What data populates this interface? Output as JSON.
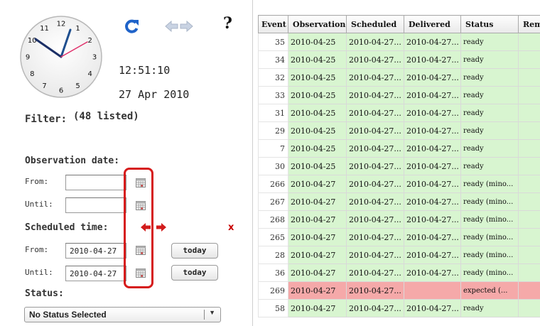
{
  "clock": {
    "numerals": [
      "12",
      "1",
      "2",
      "3",
      "4",
      "5",
      "6",
      "7",
      "8",
      "9",
      "10",
      "11"
    ],
    "time": "12:51:10",
    "date": "27 Apr 2010"
  },
  "toolbar": {
    "refresh_icon": "refresh-icon",
    "back_icon": "arrow-left-icon",
    "forward_icon": "arrow-right-icon",
    "help_label": "?"
  },
  "filter": {
    "label": "Filter:",
    "count": "(48 listed)",
    "observation": {
      "title": "Observation date:",
      "from_label": "From:",
      "from_value": "",
      "until_label": "Until:",
      "until_value": ""
    },
    "scheduled": {
      "title": "Scheduled time:",
      "from_label": "From:",
      "from_value": "2010-04-27",
      "until_label": "Until:",
      "until_value": "2010-04-27",
      "today_label": "today",
      "clear_label": "x"
    },
    "status": {
      "title": "Status:",
      "selected": "No Status Selected",
      "caret": "▼"
    }
  },
  "colors": {
    "ok_row": "#d8f5d0",
    "expected_row": "#f5a9a9",
    "highlight_box": "#d61b1b",
    "refresh_icon": "#1f63c9"
  },
  "table": {
    "columns": [
      "Event",
      "Observation",
      "Scheduled",
      "Delivered",
      "Status",
      "Remark"
    ],
    "rows": [
      {
        "id": "35",
        "obs": "2010-04-25",
        "sched": "2010-04-27...",
        "deliv": "2010-04-27...",
        "status": "ready",
        "state": "ok"
      },
      {
        "id": "34",
        "obs": "2010-04-25",
        "sched": "2010-04-27...",
        "deliv": "2010-04-27...",
        "status": "ready",
        "state": "ok"
      },
      {
        "id": "32",
        "obs": "2010-04-25",
        "sched": "2010-04-27...",
        "deliv": "2010-04-27...",
        "status": "ready",
        "state": "ok"
      },
      {
        "id": "33",
        "obs": "2010-04-25",
        "sched": "2010-04-27...",
        "deliv": "2010-04-27...",
        "status": "ready",
        "state": "ok"
      },
      {
        "id": "31",
        "obs": "2010-04-25",
        "sched": "2010-04-27...",
        "deliv": "2010-04-27...",
        "status": "ready",
        "state": "ok"
      },
      {
        "id": "29",
        "obs": "2010-04-25",
        "sched": "2010-04-27...",
        "deliv": "2010-04-27...",
        "status": "ready",
        "state": "ok"
      },
      {
        "id": "7",
        "obs": "2010-04-25",
        "sched": "2010-04-27...",
        "deliv": "2010-04-27...",
        "status": "ready",
        "state": "ok"
      },
      {
        "id": "30",
        "obs": "2010-04-25",
        "sched": "2010-04-27...",
        "deliv": "2010-04-27...",
        "status": "ready",
        "state": "ok"
      },
      {
        "id": "266",
        "obs": "2010-04-27",
        "sched": "2010-04-27...",
        "deliv": "2010-04-27...",
        "status": "ready (mino...",
        "state": "ok"
      },
      {
        "id": "267",
        "obs": "2010-04-27",
        "sched": "2010-04-27...",
        "deliv": "2010-04-27...",
        "status": "ready (mino...",
        "state": "ok"
      },
      {
        "id": "268",
        "obs": "2010-04-27",
        "sched": "2010-04-27...",
        "deliv": "2010-04-27...",
        "status": "ready (mino...",
        "state": "ok"
      },
      {
        "id": "265",
        "obs": "2010-04-27",
        "sched": "2010-04-27...",
        "deliv": "2010-04-27...",
        "status": "ready (mino...",
        "state": "ok"
      },
      {
        "id": "28",
        "obs": "2010-04-27",
        "sched": "2010-04-27...",
        "deliv": "2010-04-27...",
        "status": "ready (mino...",
        "state": "ok"
      },
      {
        "id": "36",
        "obs": "2010-04-27",
        "sched": "2010-04-27...",
        "deliv": "2010-04-27...",
        "status": "ready (mino...",
        "state": "ok"
      },
      {
        "id": "269",
        "obs": "2010-04-27",
        "sched": "2010-04-27...",
        "deliv": "",
        "status": "expected (...",
        "state": "bad"
      },
      {
        "id": "58",
        "obs": "2010-04-27",
        "sched": "2010-04-27...",
        "deliv": "2010-04-27...",
        "status": "ready",
        "state": "ok"
      }
    ]
  }
}
